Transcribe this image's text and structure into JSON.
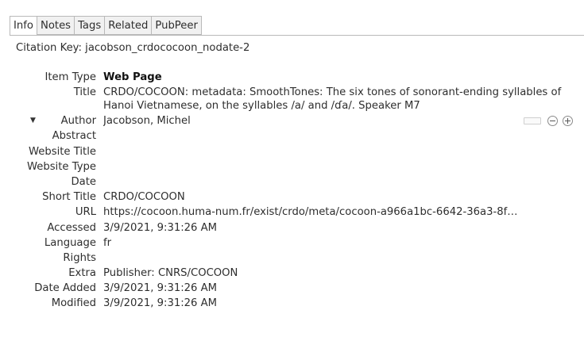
{
  "tabs": [
    {
      "label": "Info",
      "active": true
    },
    {
      "label": "Notes",
      "active": false
    },
    {
      "label": "Tags",
      "active": false
    },
    {
      "label": "Related",
      "active": false
    },
    {
      "label": "PubPeer",
      "active": false
    }
  ],
  "citation_key": "Citation Key: jacobson_crdococoon_nodate-2",
  "fields": {
    "item_type": {
      "label": "Item Type",
      "value": "Web Page"
    },
    "title": {
      "label": "Title",
      "value": "CRDO/COCOON: metadata: SmoothTones: The six tones of sonorant-ending syllables of Hanoi Vietnamese, on the syllables /a/ and /ɗa/. Speaker M7"
    },
    "author": {
      "label": "Author",
      "value": "Jacobson, Michel"
    },
    "abstract": {
      "label": "Abstract",
      "value": ""
    },
    "website_title": {
      "label": "Website Title",
      "value": ""
    },
    "website_type": {
      "label": "Website Type",
      "value": ""
    },
    "date": {
      "label": "Date",
      "value": ""
    },
    "short_title": {
      "label": "Short Title",
      "value": "CRDO/COCOON"
    },
    "url": {
      "label": "URL",
      "value": "https://cocoon.huma-num.fr/exist/crdo/meta/cocoon-a966a1bc-6642-36a3-8f…"
    },
    "accessed": {
      "label": "Accessed",
      "value": "3/9/2021, 9:31:26 AM"
    },
    "language": {
      "label": "Language",
      "value": "fr"
    },
    "rights": {
      "label": "Rights",
      "value": ""
    },
    "extra": {
      "label": "Extra",
      "value": "Publisher: CNRS/COCOON"
    },
    "date_added": {
      "label": "Date Added",
      "value": "3/9/2021, 9:31:26 AM"
    },
    "modified": {
      "label": "Modified",
      "value": "3/9/2021, 9:31:26 AM"
    }
  },
  "icons": {
    "disclosure": "triangle-down-icon",
    "remove_creator": "minus-circle-icon",
    "add_creator": "plus-circle-icon"
  }
}
